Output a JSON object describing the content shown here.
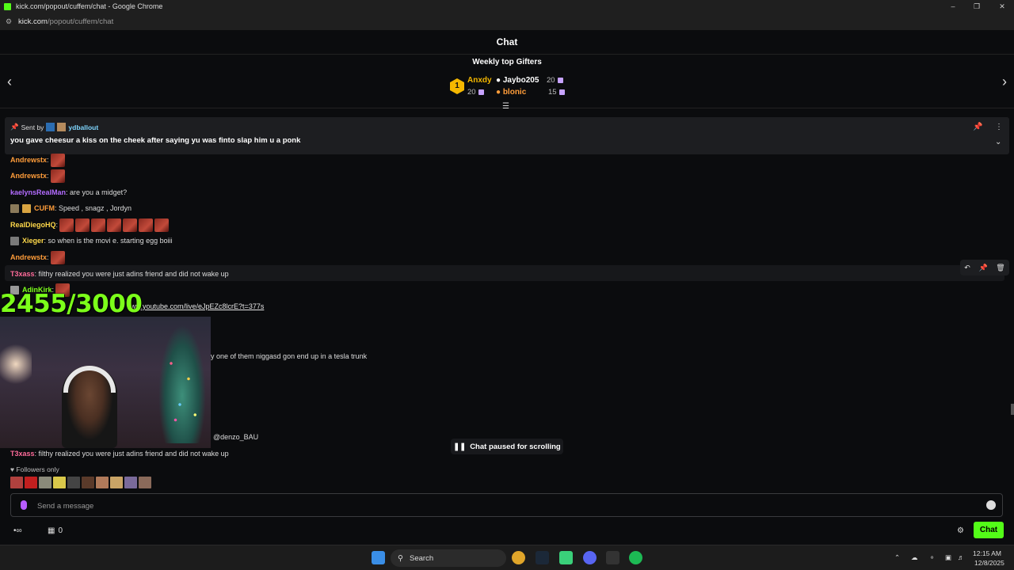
{
  "browser": {
    "window_title": "kick.com/popout/cuffem/chat - Google Chrome",
    "url_host": "kick.com",
    "url_path": "/popout/cuffem/chat"
  },
  "chat": {
    "title": "Chat",
    "gifters": {
      "title": "Weekly top Gifters",
      "rank1": {
        "rank": "1",
        "name": "Anxdy",
        "count": "20"
      },
      "entries": [
        {
          "name": "Jaybo205",
          "count": "20"
        },
        {
          "name": "blonic",
          "count": "15"
        }
      ]
    },
    "pinned": {
      "sent_by_label": "Sent by",
      "username": "ydballout",
      "message": "you gave cheesur a kiss on the cheek after saying yu was finto slap him u a ponk"
    },
    "messages": [
      {
        "user": "Andrewstx",
        "color": "#ff9d3a",
        "text": ""
      },
      {
        "user": "Andrewstx",
        "color": "#ff9d3a",
        "text": ""
      },
      {
        "user": "kaelynsRealMan",
        "color": "#b36cff",
        "text": ": are you a midget?"
      },
      {
        "user": "CUFM",
        "color": "#ff9d3a",
        "text": ": Speed , snagz , Jordyn"
      },
      {
        "user": "RealDiegoHQ",
        "color": "#ffd94a",
        "text": ":"
      },
      {
        "user": "Xieger",
        "color": "#ffd94a",
        "text": ": so when is the movi e. starting egg boiii"
      },
      {
        "user": "Andrewstx",
        "color": "#ff9d3a",
        "text": ":"
      },
      {
        "user": "T3xass",
        "color": "#ff6b9a",
        "text": ": filthy realized you were just adins friend and did not wake up"
      },
      {
        "user": "AdinKirk",
        "color": "#7cff1a",
        "text": ":"
      },
      {
        "user": "",
        "color": "#ddd",
        "text": "ww.youtube.com/live/eJpEZc8lcrE?t=377s"
      },
      {
        "user": "",
        "color": "#ddd",
        "text": "y one of them niggasd gon end up in a tesla trunk"
      },
      {
        "user": "",
        "color": "#ddd",
        "text": "@denzo_BAU"
      },
      {
        "user": "T3xass",
        "color": "#ff6b9a",
        "text": ": filthy realized you were just adins friend and did not wake up"
      }
    ],
    "overlay_counter": "2455/3000",
    "paused_label": "Chat paused for scrolling",
    "followers_only": "Followers only",
    "input_placeholder": "Send a message",
    "bottom": {
      "points": "0",
      "chat_button": "Chat"
    }
  },
  "taskbar": {
    "search_label": "Search",
    "time": "12:15 AM",
    "date": "12/8/2025"
  },
  "colors": {
    "accent": "#53fc18",
    "gifter_gold": "#f5b800",
    "gift_purple": "#c7a3ff"
  }
}
